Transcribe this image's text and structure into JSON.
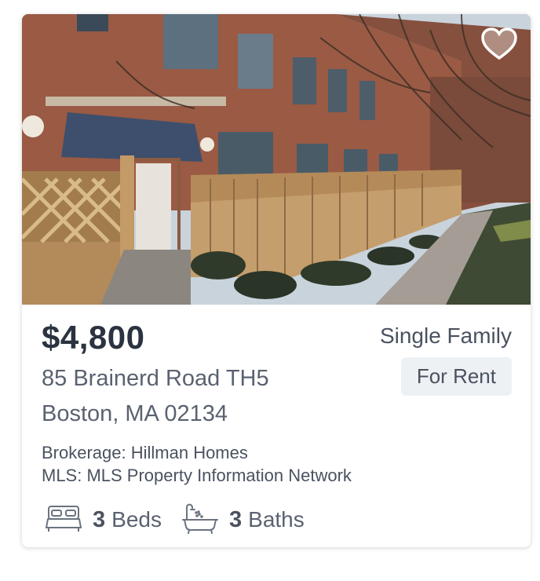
{
  "listing": {
    "price": "$4,800",
    "property_type": "Single Family",
    "status": "For Rent",
    "address_line1": "85 Brainerd Road TH5",
    "address_line2": "Boston, MA 02134",
    "brokerage": "Brokerage: Hillman Homes",
    "mls": "MLS: MLS Property Information Network",
    "beds_count": "3",
    "beds_label": "Beds",
    "baths_count": "3",
    "baths_label": "Baths"
  },
  "icons": {
    "favorite": "heart-icon",
    "beds": "bed-icon",
    "baths": "bathtub-icon"
  },
  "colors": {
    "price_text": "#2b3340",
    "status_badge_bg": "#eef1f4",
    "body_text": "#4a5260"
  }
}
